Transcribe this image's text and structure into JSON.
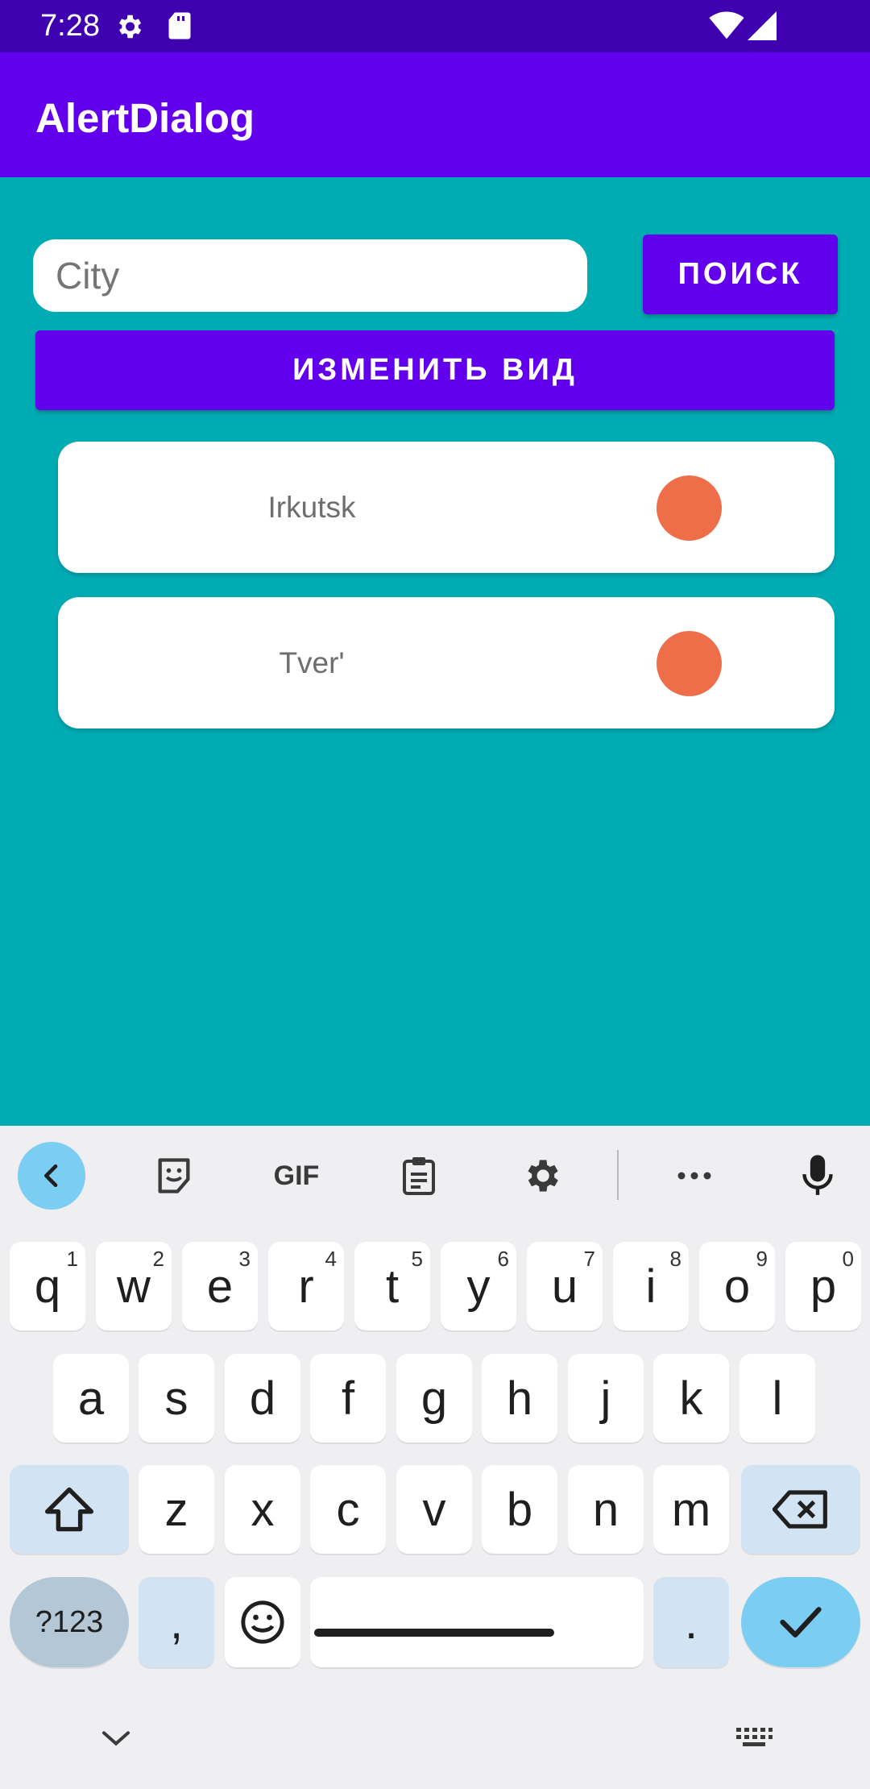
{
  "status_bar": {
    "time": "7:28",
    "icons": [
      "gear-icon",
      "sd-card-icon",
      "wifi-icon",
      "cellular-signal-icon"
    ]
  },
  "app_bar": {
    "title": "AlertDialog"
  },
  "search": {
    "placeholder": "City",
    "value": "",
    "button_label": "ПОИСК"
  },
  "change_view_button": {
    "label": "ИЗМЕНИТЬ ВИД"
  },
  "cities": [
    {
      "name": "Irkutsk",
      "dot_color": "#EE6E4A"
    },
    {
      "name": "Tver'",
      "dot_color": "#EE6E4A"
    }
  ],
  "colors": {
    "status_bar": "#3F00B0",
    "app_bar": "#6200EE",
    "background": "#00ACB4",
    "accent": "#6200EE"
  },
  "keyboard": {
    "toolbar": [
      "back-icon",
      "sticker-icon",
      "gif-icon",
      "clipboard-icon",
      "settings-icon",
      "more-icon",
      "mic-icon"
    ],
    "gif_label": "GIF",
    "row1": [
      {
        "key": "q",
        "hint": "1"
      },
      {
        "key": "w",
        "hint": "2"
      },
      {
        "key": "e",
        "hint": "3"
      },
      {
        "key": "r",
        "hint": "4"
      },
      {
        "key": "t",
        "hint": "5"
      },
      {
        "key": "y",
        "hint": "6"
      },
      {
        "key": "u",
        "hint": "7"
      },
      {
        "key": "i",
        "hint": "8"
      },
      {
        "key": "o",
        "hint": "9"
      },
      {
        "key": "p",
        "hint": "0"
      }
    ],
    "row2": [
      "a",
      "s",
      "d",
      "f",
      "g",
      "h",
      "j",
      "k",
      "l"
    ],
    "row3": [
      "z",
      "x",
      "c",
      "v",
      "b",
      "n",
      "m"
    ],
    "symbols_label": "?123",
    "comma": ",",
    "period": "."
  }
}
